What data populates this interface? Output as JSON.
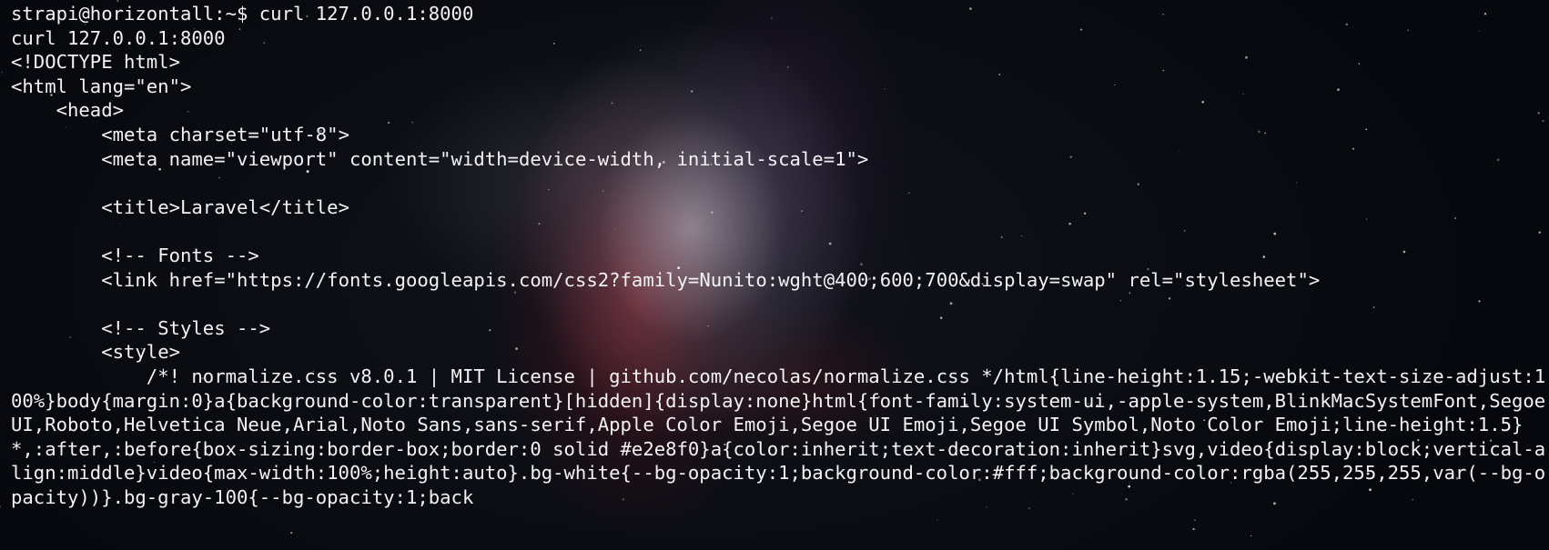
{
  "terminal": {
    "lines": [
      "strapi@horizontall:~$ curl 127.0.0.1:8000",
      "curl 127.0.0.1:8000",
      "<!DOCTYPE html>",
      "<html lang=\"en\">",
      "    <head>",
      "        <meta charset=\"utf-8\">",
      "        <meta name=\"viewport\" content=\"width=device-width, initial-scale=1\">",
      "",
      "        <title>Laravel</title>",
      "",
      "        <!-- Fonts -->",
      "        <link href=\"https://fonts.googleapis.com/css2?family=Nunito:wght@400;600;700&display=swap\" rel=\"stylesheet\">",
      "",
      "        <!-- Styles -->",
      "        <style>",
      "            /*! normalize.css v8.0.1 | MIT License | github.com/necolas/normalize.css */html{line-height:1.15;-webkit-text-size-adjust:100%}body{margin:0}a{background-color:transparent}[hidden]{display:none}html{font-family:system-ui,-apple-system,BlinkMacSystemFont,Segoe UI,Roboto,Helvetica Neue,Arial,Noto Sans,sans-serif,Apple Color Emoji,Segoe UI Emoji,Segoe UI Symbol,Noto Color Emoji;line-height:1.5}*,:after,:before{box-sizing:border-box;border:0 solid #e2e8f0}a{color:inherit;text-decoration:inherit}svg,video{display:block;vertical-align:middle}video{max-width:100%;height:auto}.bg-white{--bg-opacity:1;background-color:#fff;background-color:rgba(255,255,255,var(--bg-opacity))}.bg-gray-100{--bg-opacity:1;back"
    ]
  },
  "colors": {
    "text": "#f2f2f2",
    "background": "#06080d"
  }
}
